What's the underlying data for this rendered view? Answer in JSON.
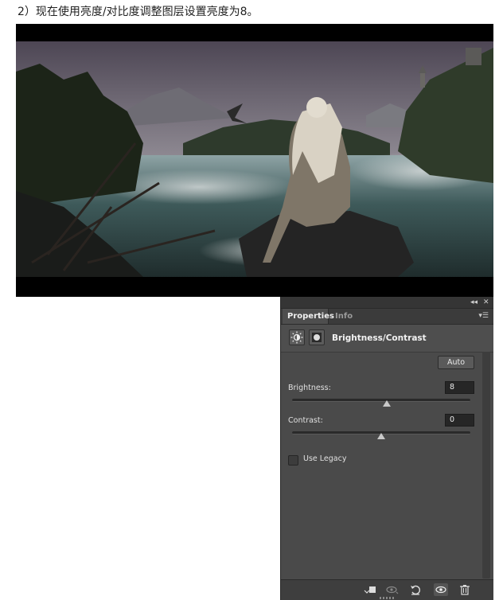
{
  "caption": "2）现在使用亮度/对比度调整图层设置亮度为8。",
  "panel": {
    "tabs": [
      {
        "label": "Properties",
        "active": true
      },
      {
        "label": "Info",
        "active": false
      }
    ],
    "collapse_icon": "double-chevron-left-icon",
    "close_icon": "close-icon",
    "menu_icon": "panel-menu-icon",
    "adjustment_title": "Brightness/Contrast",
    "auto_label": "Auto",
    "brightness": {
      "label": "Brightness:",
      "value": "8",
      "slider_fraction": 0.532
    },
    "contrast": {
      "label": "Contrast:",
      "value": "0",
      "slider_fraction": 0.5
    },
    "use_legacy": {
      "label": "Use Legacy",
      "checked": false
    },
    "bottom_icons": [
      "clip-to-layer-icon",
      "view-previous-state-icon",
      "reset-icon",
      "visibility-eye-icon",
      "trash-icon"
    ]
  },
  "colors": {
    "panel_bg": "#4a4a4a",
    "panel_dark": "#3b3b3b",
    "field_bg": "#262626",
    "text": "#e6e6e6"
  }
}
